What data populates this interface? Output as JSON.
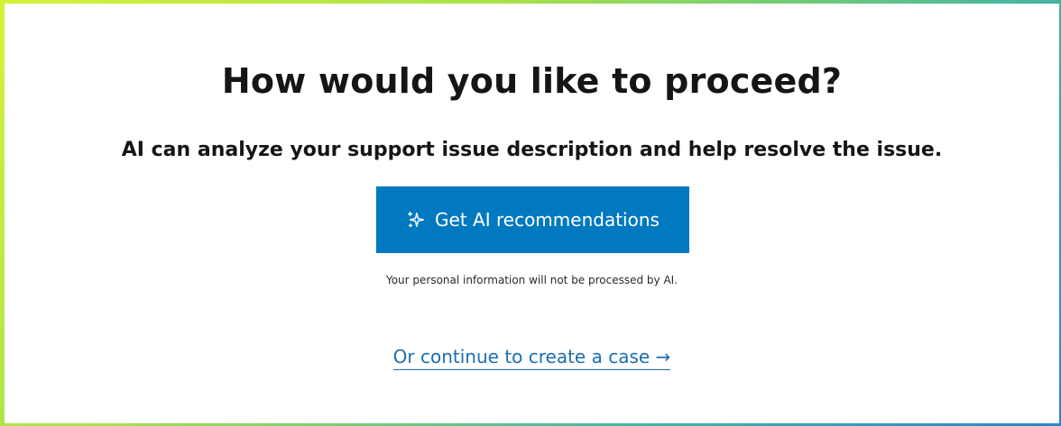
{
  "prompt": {
    "title": "How would you like to proceed?",
    "description": "AI can analyze your support issue description and help resolve the issue."
  },
  "ai_button": {
    "label": "Get AI recommendations",
    "icon": "sparkle-icon"
  },
  "privacy_notice": "Your personal information will not be processed by AI.",
  "continue_link": {
    "label": "Or continue to create a case",
    "arrow": "→"
  },
  "colors": {
    "primary_button": "#0079c1",
    "link": "#1a6fb3",
    "heading_text": "#151515",
    "border_gradient_start": "#d5f23a",
    "border_gradient_end": "#2a84c9"
  }
}
